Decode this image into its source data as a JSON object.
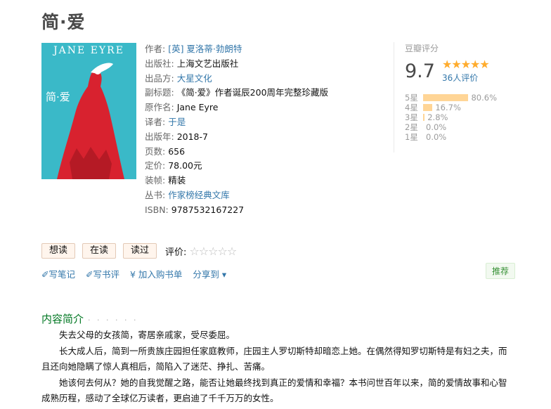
{
  "title": "简·爱",
  "cover": {
    "en_title": "JANE EYRE",
    "cn_title": "简·爱"
  },
  "info": {
    "author_label": "作者:",
    "author": "[英] 夏洛蒂·勃朗特",
    "publisher_label": "出版社:",
    "publisher": "上海文艺出版社",
    "producer_label": "出品方:",
    "producer": "大星文化",
    "subtitle_label": "副标题:",
    "subtitle": "《简·爱》作者诞辰200周年完整珍藏版",
    "original_label": "原作名:",
    "original": "Jane Eyre",
    "translator_label": "译者:",
    "translator": "于是",
    "year_label": "出版年:",
    "year": "2018-7",
    "pages_label": "页数:",
    "pages": "656",
    "price_label": "定价:",
    "price": "78.00元",
    "binding_label": "装帧:",
    "binding": "精装",
    "series_label": "丛书:",
    "series": "作家榜经典文库",
    "isbn_label": "ISBN:",
    "isbn": "9787532167227"
  },
  "rating": {
    "label": "豆瓣评分",
    "score": "9.7",
    "stars": "★★★★★",
    "count": "36人评价",
    "breakdown": [
      {
        "star": "5星",
        "pct": "80.6%",
        "value": 80.6
      },
      {
        "star": "4星",
        "pct": "16.7%",
        "value": 16.7
      },
      {
        "star": "3星",
        "pct": "2.8%",
        "value": 2.8
      },
      {
        "star": "2星",
        "pct": "0.0%",
        "value": 0.0
      },
      {
        "star": "1星",
        "pct": "0.0%",
        "value": 0.0
      }
    ]
  },
  "actions": {
    "want": "想读",
    "reading": "在读",
    "read": "读过",
    "rate_label": "评价:",
    "empty_stars": "☆☆☆☆☆"
  },
  "links": {
    "note": "✐写笔记",
    "review": "✐写书评",
    "cart": "¥ 加入购书单",
    "share": "分享到 ▾"
  },
  "recommend": "推荐",
  "intro": {
    "heading": "内容简介",
    "dots": "· · · · · ·",
    "paragraphs": [
      "失去父母的女孩简，寄居亲戚家，受尽委屈。",
      "长大成人后，简到一所贵族庄园担任家庭教师，庄园主人罗切斯特却暗恋上她。在偶然得知罗切斯特是有妇之夫，而且还向她隐瞒了惊人真相后，简陷入了迷茫、挣扎、苦痛。",
      "她该何去何从？她的自我觉醒之路，能否让她最终找到真正的爱情和幸福？本书问世百年以来，简的爱情故事和心智成熟历程，感动了全球亿万读者，更启迪了千千万万的女性。"
    ]
  },
  "colors": {
    "link": "#3377aa",
    "star": "#ffac2d",
    "bar": "#ffd596",
    "intro_heading": "#007722",
    "cover_bg": "#3ab9c8",
    "cover_dress": "#d8222f"
  }
}
